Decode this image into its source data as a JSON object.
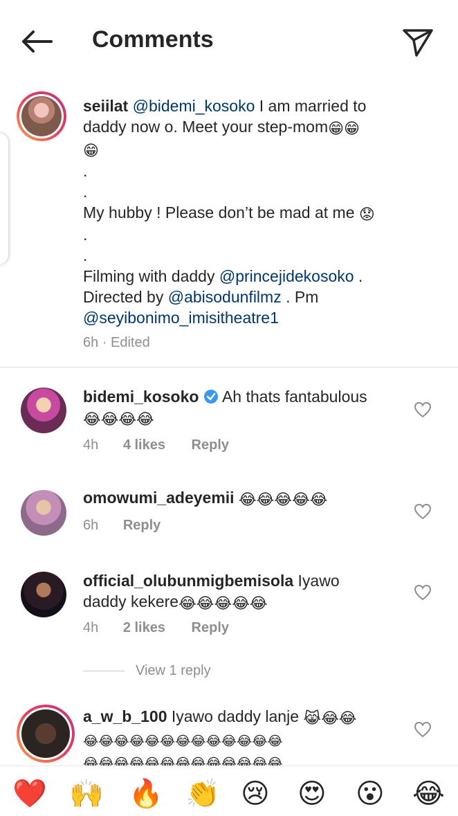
{
  "header": {
    "title": "Comments",
    "back_icon": "back-arrow-icon",
    "share_icon": "paper-plane-icon"
  },
  "caption": {
    "username": "seiilat",
    "mention1": "@bidemi_kosoko",
    "text1": " I am married to",
    "text2": "daddy now o. Meet your step-mom",
    "emoji_grin": "😁",
    "dot": ".",
    "text3": "My hubby ! Please don’t be mad at me ",
    "emoji_sad": "😟",
    "text4": "Filming with daddy ",
    "mention2": "@princejidekosoko",
    "text4b": " .",
    "text5": "Directed by ",
    "mention3": "@abisodunfilmz",
    "text5b": " . Pm",
    "mention4": "@seyibonimo_imisitheatre1",
    "time": "6h",
    "edited": " · Edited"
  },
  "comments": [
    {
      "username": "bidemi_kosoko",
      "verified": true,
      "text": " Ah thats fantabulous",
      "emojis": "😂😂😂😂",
      "time": "4h",
      "likes": "4 likes",
      "reply": "Reply"
    },
    {
      "username": "omowumi_adeyemii",
      "text": " ",
      "emojis": "😂😂😂😂😂",
      "time": "6h",
      "reply": "Reply"
    },
    {
      "username": "official_olubunmigbemisola",
      "text": " Iyawo",
      "text2": "daddy kekere",
      "emojis": "😂😂😂😂😂",
      "time": "4h",
      "likes": "2 likes",
      "reply": "Reply"
    },
    {
      "username": "a_w_b_100",
      "text": " Iyawo daddy lanje ",
      "emojis_line1": "😹😂😂",
      "emojis_line2": "😂😂😂😂😂😂😂😂😂😂😂😂😂",
      "emojis_line3": "😂😂😂😂😂😂😂😂😂😂😂😂😂"
    }
  ],
  "view_replies": "View 1 reply",
  "reaction_bar": [
    "❤️",
    "🙌",
    "🔥",
    "👏",
    "😢",
    "😍",
    "😮",
    "😂"
  ],
  "colors": {
    "link": "#00376b",
    "muted": "#8e8e8e",
    "verified": "#3897f0"
  }
}
